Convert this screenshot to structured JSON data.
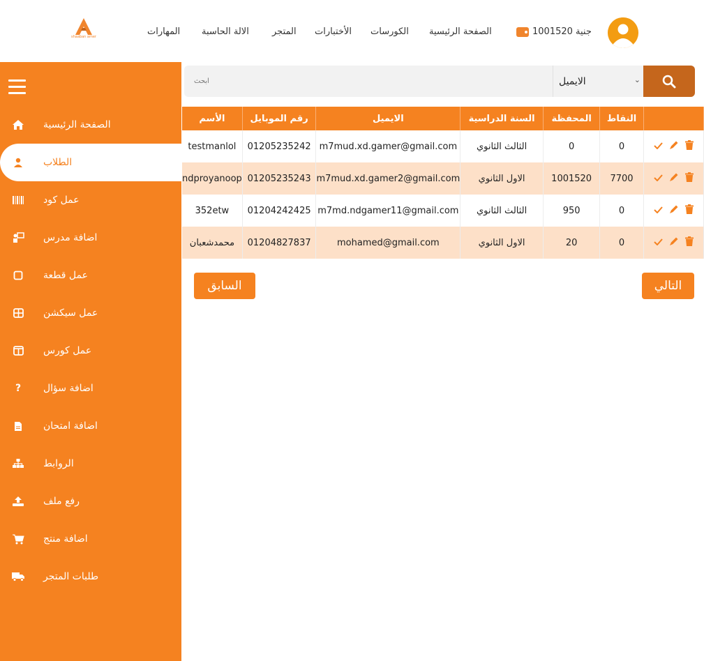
{
  "logo": {
    "text": "shaaban amer"
  },
  "nav": {
    "skills": "المهارات",
    "calculator": "الالة الحاسبة",
    "store": "المتجر",
    "exams": "الأختبارات",
    "courses": "الكورسات",
    "home": "الصفحة الرئيسية"
  },
  "wallet": {
    "label": "جنية 1001520"
  },
  "sidebar": {
    "items": [
      {
        "label": "الصفحة الرئيسية",
        "icon": "home-icon"
      },
      {
        "label": "الطلاب",
        "icon": "user-icon",
        "active": true
      },
      {
        "label": "عمل كود",
        "icon": "barcode-icon"
      },
      {
        "label": "اضافة مدرس",
        "icon": "teacher-icon"
      },
      {
        "label": "عمل قطعة",
        "icon": "square-icon"
      },
      {
        "label": "عمل سيكشن",
        "icon": "grid-icon"
      },
      {
        "label": "عمل كورس",
        "icon": "columns-icon"
      },
      {
        "label": "اضافة سؤال",
        "icon": "question-icon"
      },
      {
        "label": "اضافة امتحان",
        "icon": "exam-icon"
      },
      {
        "label": "الروابط",
        "icon": "sitemap-icon"
      },
      {
        "label": "رفع ملف",
        "icon": "upload-icon"
      },
      {
        "label": "اضافة منتج",
        "icon": "cart-icon"
      },
      {
        "label": "طلبات المتجر",
        "icon": "truck-icon"
      }
    ]
  },
  "search": {
    "placeholder": "ابحث",
    "filter_value": "الايميل"
  },
  "table": {
    "headers": {
      "points": "النقاط",
      "wallet": "المحفظة",
      "year": "السنة الدراسية",
      "email": "الايميل",
      "mobile": "رقم الموبايل",
      "name": "الأسم"
    },
    "rows": [
      {
        "points": "0",
        "wallet": "0",
        "year": "الثالث الثانوي",
        "email": "m7mud.xd.gamer@gmail.com",
        "mobile": "01205235242",
        "name": "testmanlol"
      },
      {
        "points": "7700",
        "wallet": "1001520",
        "year": "الاول الثانوي",
        "email": "m7mud.xd.gamer2@gmail.com",
        "mobile": "01205235243",
        "name": "ndproyanoop"
      },
      {
        "points": "0",
        "wallet": "950",
        "year": "الثالث الثانوي",
        "email": "m7md.ndgamer11@gmail.com",
        "mobile": "01204242425",
        "name": "352etw"
      },
      {
        "points": "0",
        "wallet": "20",
        "year": "الاول الثانوي",
        "email": "mohamed@gmail.com",
        "mobile": "01204827837",
        "name": "محمدشعبان"
      }
    ]
  },
  "pager": {
    "next": "التالي",
    "prev": "السابق"
  },
  "colors": {
    "accent": "#f58220",
    "accent_dark": "#c5661c",
    "row_alt": "#fde0c8"
  }
}
